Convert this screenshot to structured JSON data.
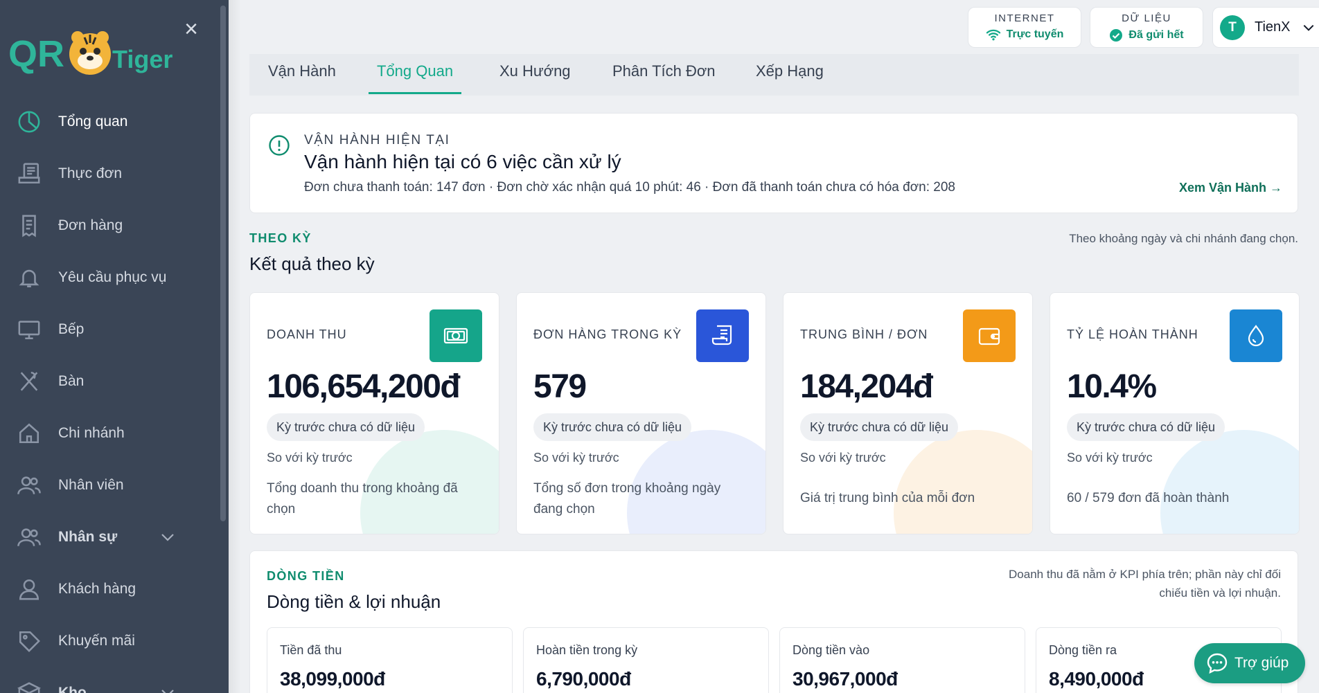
{
  "sidebar": {
    "logo_text": "QR Tiger",
    "items": [
      {
        "label": "Tổng quan",
        "icon": "pie-chart-icon",
        "active": true
      },
      {
        "label": "Thực đơn",
        "icon": "menu-board-icon"
      },
      {
        "label": "Đơn hàng",
        "icon": "receipt-icon"
      },
      {
        "label": "Yêu cầu phục vụ",
        "icon": "bell-icon"
      },
      {
        "label": "Bếp",
        "icon": "monitor-icon"
      },
      {
        "label": "Bàn",
        "icon": "utensils-icon"
      },
      {
        "label": "Chi nhánh",
        "icon": "home-icon"
      },
      {
        "label": "Nhân viên",
        "icon": "users-icon"
      },
      {
        "label": "Nhân sự",
        "icon": "users-icon",
        "expandable": true
      },
      {
        "label": "Khách hàng",
        "icon": "user-icon"
      },
      {
        "label": "Khuyến mãi",
        "icon": "tag-icon"
      },
      {
        "label": "Kho",
        "icon": "box-icon",
        "expandable": true
      }
    ]
  },
  "topbar": {
    "internet": {
      "label": "INTERNET",
      "value": "Trực tuyến",
      "icon": "wifi-icon"
    },
    "data": {
      "label": "DỮ LIỆU",
      "value": "Đã gửi hết",
      "icon": "check-circle-icon"
    },
    "user": {
      "initial": "T",
      "name": "TienX"
    }
  },
  "tabs": [
    {
      "label": "Vận Hành"
    },
    {
      "label": "Tổng Quan",
      "active": true
    },
    {
      "label": "Xu Hướng"
    },
    {
      "label": "Phân Tích Đơn"
    },
    {
      "label": "Xếp Hạng"
    }
  ],
  "alert": {
    "eyebrow": "VẬN HÀNH HIỆN TẠI",
    "title": "Vận hành hiện tại có 6 việc cần xử lý",
    "desc": "Đơn chưa thanh toán: 147 đơn · Đơn chờ xác nhận quá 10 phút: 46 · Đơn đã thanh toán chưa có hóa đơn: 208",
    "link": "Xem Vận Hành →"
  },
  "period": {
    "eyebrow": "THEO KỲ",
    "title": "Kết quả theo kỳ",
    "note": "Theo khoảng ngày và chi nhánh đang chọn."
  },
  "kpis": [
    {
      "label": "DOANH THU",
      "value": "106,654,200đ",
      "badge": "Kỳ trước chưa có dữ liệu",
      "compare": "So với kỳ trước",
      "desc": "Tổng doanh thu trong khoảng đã chọn",
      "icon": "cash-icon",
      "color": "#15a58a",
      "tint": "#e6f6f2"
    },
    {
      "label": "ĐƠN HÀNG TRONG KỲ",
      "value": "579",
      "badge": "Kỳ trước chưa có dữ liệu",
      "compare": "So với kỳ trước",
      "desc": "Tổng số đơn trong khoảng ngày đang chọn",
      "icon": "receipt-icon",
      "color": "#2a56d9",
      "tint": "#e9eefc"
    },
    {
      "label": "TRUNG BÌNH / ĐƠN",
      "value": "184,204đ",
      "badge": "Kỳ trước chưa có dữ liệu",
      "compare": "So với kỳ trước",
      "desc": "Giá trị trung bình của mỗi đơn",
      "icon": "wallet-icon",
      "color": "#f39a18",
      "tint": "#fdf2e3"
    },
    {
      "label": "TỶ LỆ HOÀN THÀNH",
      "value": "10.4%",
      "badge": "Kỳ trước chưa có dữ liệu",
      "compare": "So với kỳ trước",
      "desc": "60 / 579 đơn đã hoàn thành",
      "icon": "drop-icon",
      "color": "#1a86d3",
      "tint": "#e6f3fb"
    }
  ],
  "cashflow": {
    "eyebrow": "DÒNG TIỀN",
    "title": "Dòng tiền & lợi nhuận",
    "note_line1": "Doanh thu đã nằm ở KPI phía trên; phần này chỉ đối",
    "note_line2": "chiếu tiền và lợi nhuận.",
    "cards": [
      {
        "label": "Tiền đã thu",
        "value": "38,099,000đ"
      },
      {
        "label": "Hoàn tiền trong kỳ",
        "value": "6,790,000đ"
      },
      {
        "label": "Dòng tiền vào",
        "value": "30,967,000đ"
      },
      {
        "label": "Dòng tiền ra",
        "value": "8,490,000đ"
      }
    ]
  },
  "help": {
    "label": "Trợ giúp",
    "icon": "chat-icon"
  }
}
